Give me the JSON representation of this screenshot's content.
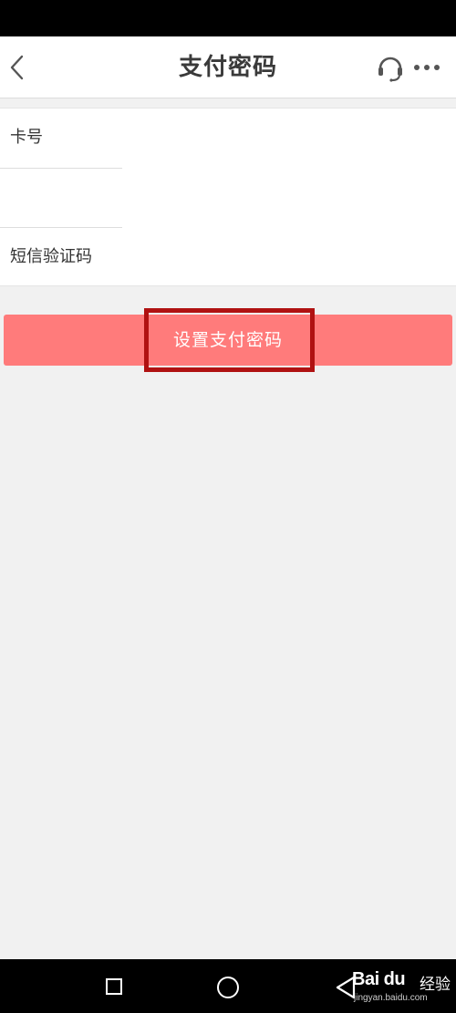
{
  "header": {
    "title": "支付密码",
    "back_icon": "chevron-left-icon",
    "support_icon": "headset-icon",
    "more_icon": "more-horizontal-icon"
  },
  "form": {
    "rows": [
      {
        "label": "卡号"
      },
      {
        "label": ""
      },
      {
        "label": "短信验证码"
      }
    ]
  },
  "actions": {
    "submit_label": "设置支付密码",
    "button_color": "#ff7b7b",
    "highlight_color": "#b01212"
  },
  "system_nav": {
    "recent_icon": "square-icon",
    "home_icon": "circle-icon",
    "back_icon": "triangle-back-icon"
  },
  "watermark": {
    "brand": "Bai du",
    "product": "经验",
    "url": "jingyan.baidu.com"
  }
}
